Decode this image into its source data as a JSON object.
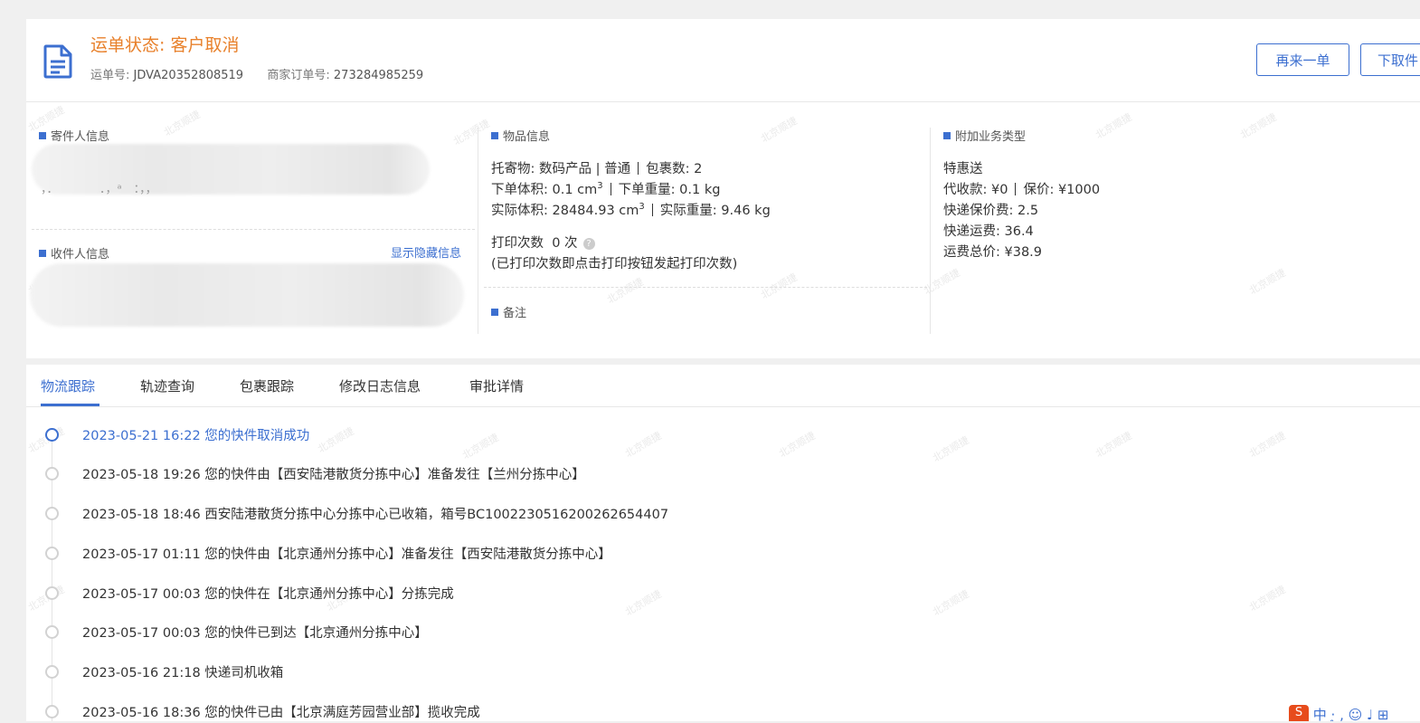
{
  "header": {
    "status_title": "运单状态: 客户取消",
    "waybill_label": "运单号:",
    "waybill_no": "JDVA20352808519",
    "merchant_label": "商家订单号:",
    "merchant_no": "273284985259",
    "btn_reorder": "再来一单",
    "btn_pickup": "下取件"
  },
  "watermark": "北京顺捷",
  "sender": {
    "title": "寄件人信息",
    "line_fragment": "，．　　　　．，ᵃ　：，，"
  },
  "receiver": {
    "title": "收件人信息",
    "toggle_link": "显示隐藏信息"
  },
  "goods": {
    "title": "物品信息",
    "cargo_label": "托寄物:",
    "cargo_value": "数码产品 | 普通",
    "packages_label": "包裹数:",
    "packages_value": "2",
    "order_volume_label": "下单体积:",
    "order_volume_value": "0.1 cm",
    "order_weight_label": "下单重量:",
    "order_weight_value": "0.1 kg",
    "actual_volume_label": "实际体积:",
    "actual_volume_value": "28484.93 cm",
    "actual_weight_label": "实际重量:",
    "actual_weight_value": "9.46 kg",
    "cube_sup": "3",
    "print_label": "打印次数",
    "print_count": "0 次",
    "help_glyph": "?",
    "print_note": "(已打印次数即点击打印按钮发起打印次数)",
    "remark_title": "备注"
  },
  "extra": {
    "title": "附加业务类型",
    "service": "特惠送",
    "cod_label": "代收款:",
    "cod_value": "¥0",
    "insured_label": "保价:",
    "insured_value": "¥1000",
    "insure_fee_label": "快递保价费:",
    "insure_fee_value": "2.5",
    "freight_label": "快递运费:",
    "freight_value": "36.4",
    "total_label": "运费总价:",
    "total_value": "¥38.9"
  },
  "tabs": [
    {
      "label": "物流跟踪",
      "active": true
    },
    {
      "label": "轨迹查询",
      "active": false
    },
    {
      "label": "包裹跟踪",
      "active": false
    },
    {
      "label": "修改日志信息",
      "active": false
    },
    {
      "label": "审批详情",
      "active": false
    }
  ],
  "timeline": [
    {
      "time": "2023-05-21 16:22",
      "text": "您的快件取消成功"
    },
    {
      "time": "2023-05-18 19:26",
      "text": "您的快件由【西安陆港散货分拣中心】准备发往【兰州分拣中心】"
    },
    {
      "time": "2023-05-18 18:46",
      "text": "西安陆港散货分拣中心分拣中心已收箱，箱号BC1002230516200262654407"
    },
    {
      "time": "2023-05-17 01:11",
      "text": "您的快件由【北京通州分拣中心】准备发往【西安陆港散货分拣中心】"
    },
    {
      "time": "2023-05-17 00:03",
      "text": "您的快件在【北京通州分拣中心】分拣完成"
    },
    {
      "time": "2023-05-17 00:03",
      "text": "您的快件已到达【北京通州分拣中心】"
    },
    {
      "time": "2023-05-16 21:18",
      "text": "快递司机收箱"
    },
    {
      "time": "2023-05-16 18:36",
      "text": "您的快件已由【北京满庭芳园营业部】揽收完成"
    }
  ],
  "ime": {
    "logo": "S",
    "text": "中 ·̥ , ☺ ♩ ⊞"
  }
}
